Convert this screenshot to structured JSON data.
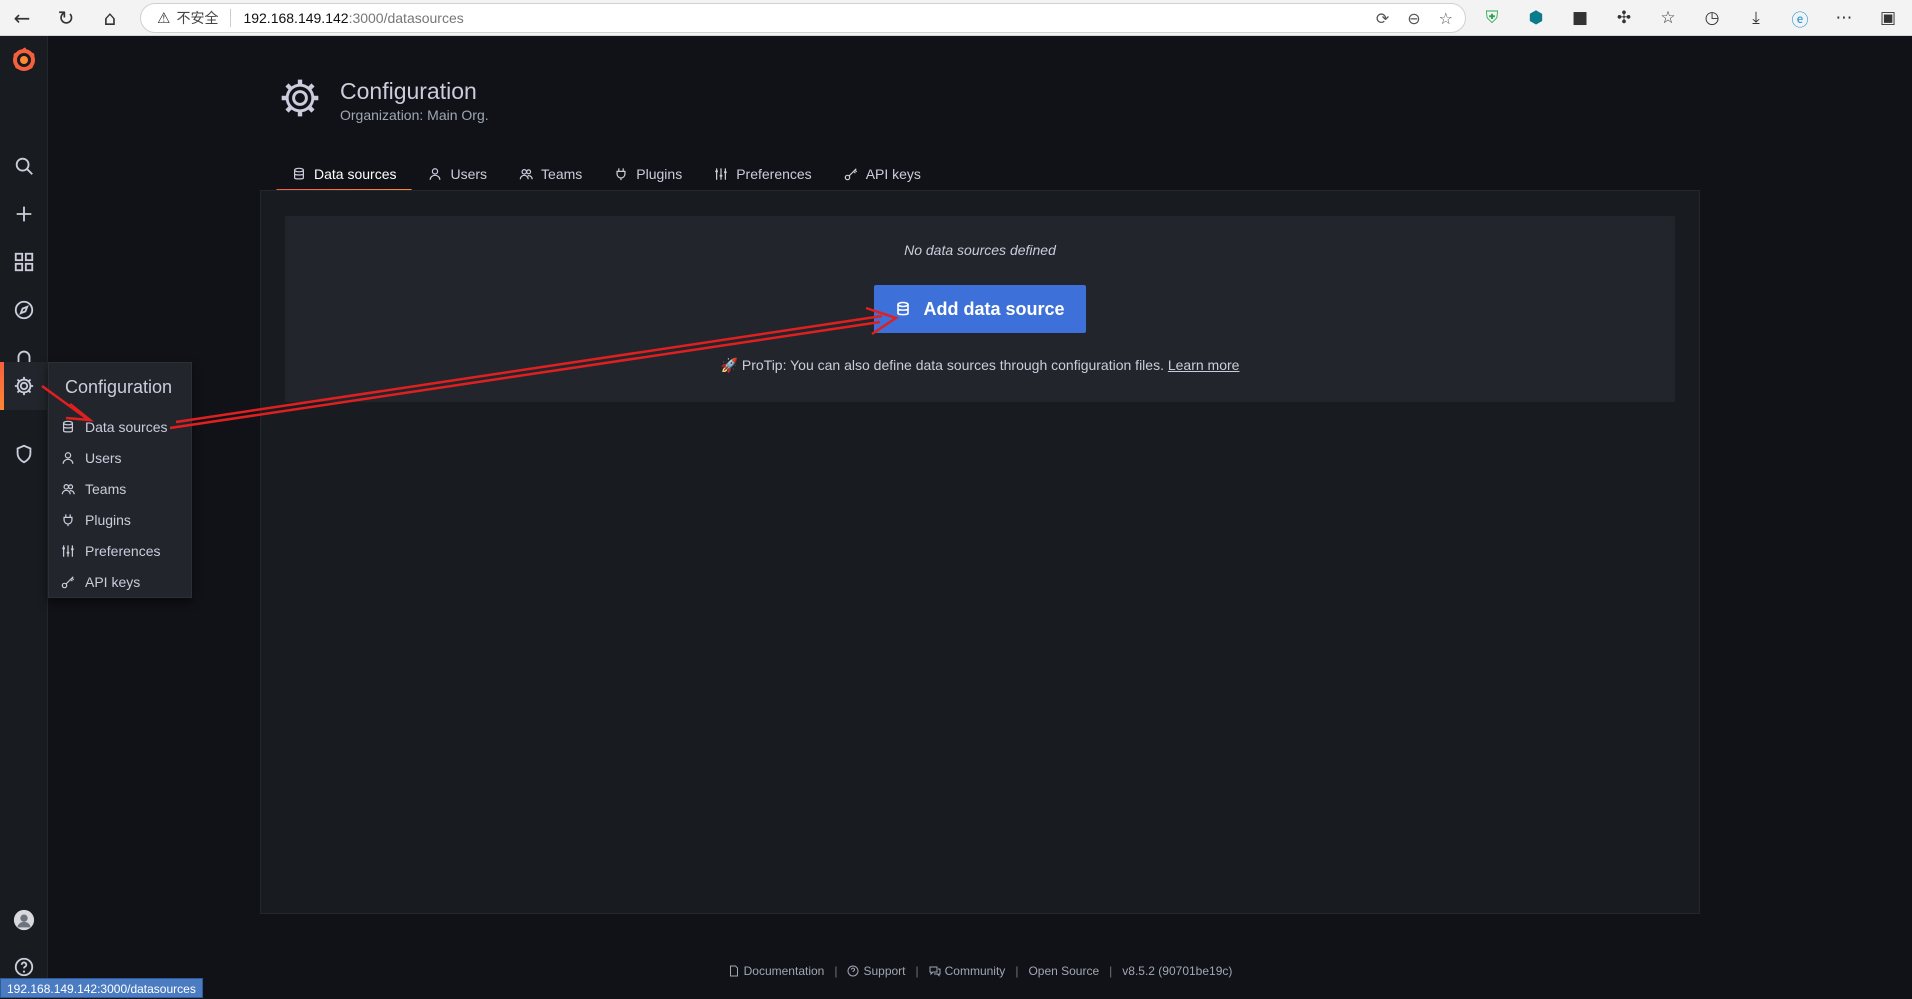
{
  "browser": {
    "insecure_label": "不安全",
    "url_host": "192.168.149.142",
    "url_path": ":3000/datasources"
  },
  "sidebar": {
    "items": [
      "search",
      "create",
      "dashboards",
      "explore",
      "alerting",
      "configuration",
      "server-admin",
      "profile",
      "help"
    ]
  },
  "config_menu": {
    "title": "Configuration",
    "items": [
      {
        "label": "Data sources",
        "icon": "database-icon"
      },
      {
        "label": "Users",
        "icon": "user-icon"
      },
      {
        "label": "Teams",
        "icon": "users-icon"
      },
      {
        "label": "Plugins",
        "icon": "plug-icon"
      },
      {
        "label": "Preferences",
        "icon": "sliders-icon"
      },
      {
        "label": "API keys",
        "icon": "key-icon"
      }
    ]
  },
  "header": {
    "title": "Configuration",
    "subtitle": "Organization: Main Org."
  },
  "tabs": [
    {
      "label": "Data sources",
      "active": true
    },
    {
      "label": "Users"
    },
    {
      "label": "Teams"
    },
    {
      "label": "Plugins"
    },
    {
      "label": "Preferences"
    },
    {
      "label": "API keys"
    }
  ],
  "empty_state": {
    "message": "No data sources defined",
    "button_label": "Add data source",
    "protip_text": "ProTip: You can also define data sources through configuration files. ",
    "protip_link": "Learn more"
  },
  "footer": {
    "documentation": "Documentation",
    "support": "Support",
    "community": "Community",
    "open_source": "Open Source",
    "version": "v8.5.2 (90701be19c)"
  },
  "status_bar_url": "192.168.149.142:3000/datasources",
  "colors": {
    "accent": "#3d71d9",
    "brand": "#f55f3e",
    "annotation": "#e02020"
  }
}
